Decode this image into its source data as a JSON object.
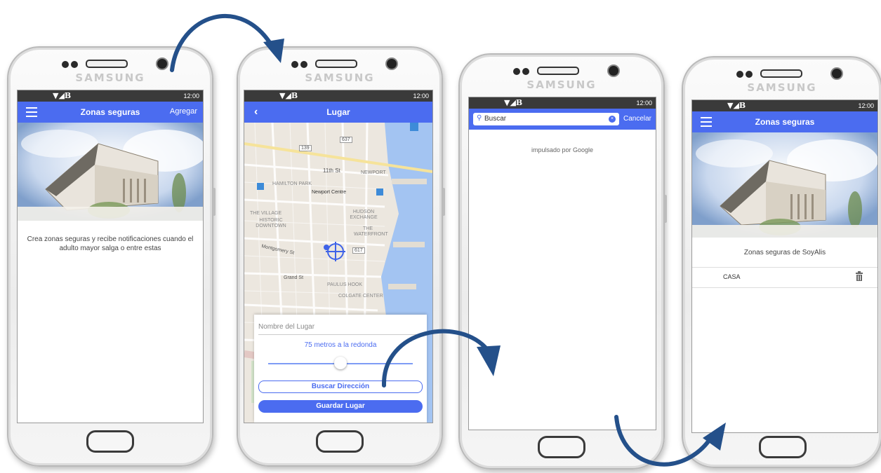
{
  "phones": {
    "brand": "SAMSUNG",
    "time": "12:00",
    "signal": "▼◢B"
  },
  "screen1": {
    "title": "Zonas seguras",
    "action": "Agregar",
    "caption": "Crea zonas seguras y recibe notificaciones cuando el adulto mayor salga o entre estas"
  },
  "screen2": {
    "title": "Lugar",
    "map_labels": {
      "newport_centre": "Newport Centre",
      "hamilton_park": "HAMILTON PARK",
      "newport": "NEWPORT",
      "eleventh": "11th St",
      "hudson": "HUDSON EXCHANGE",
      "village": "THE VILLAGE",
      "historic": "HISTORIC DOWNTOWN",
      "waterfront": "THE WATERFRONT",
      "montgomery": "Montgomery St",
      "grand": "Grand St",
      "paulus": "PAULUS HOOK",
      "colgate": "COLGATE CENTER",
      "route_139": "139",
      "route_637": "637",
      "route_617": "617"
    },
    "name_placeholder": "Nombre del Lugar",
    "radius_label": "75 metros a la redonda",
    "radius_fraction": 0.5,
    "search_button": "Buscar Dirección",
    "save_button": "Guardar Lugar"
  },
  "screen3": {
    "search_placeholder": "Buscar",
    "cancel": "Cancelar",
    "powered_by": "impulsado por Google"
  },
  "screen4": {
    "title": "Zonas seguras",
    "section_title": "Zonas seguras de SoyAlis",
    "zones": [
      "CASA"
    ]
  },
  "colors": {
    "accent": "#4b6cf0",
    "arrow": "#24508a",
    "statusbar": "#3a3a3a"
  },
  "icons": {
    "menu": "hamburger-icon",
    "back": "back-chevron-icon",
    "search": "search-icon",
    "clear": "clear-icon",
    "delete": "trash-icon",
    "location": "crosshair-location-icon"
  }
}
